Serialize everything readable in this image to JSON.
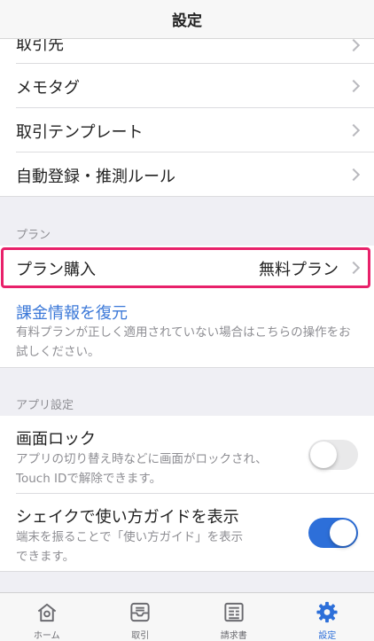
{
  "header": {
    "title": "設定"
  },
  "top_rows": [
    {
      "label": "取引先"
    },
    {
      "label": "メモタグ"
    },
    {
      "label": "取引テンプレート"
    },
    {
      "label": "自動登録・推測ルール"
    }
  ],
  "plan_section": {
    "title": "プラン",
    "purchase": {
      "label": "プラン購入",
      "value": "無料プラン"
    },
    "restore": {
      "link": "課金情報を復元",
      "description": "有料プランが正しく適用されていない場合はこちらの操作をお試しください。"
    }
  },
  "app_section": {
    "title": "アプリ設定",
    "screen_lock": {
      "label": "画面ロック",
      "description": "アプリの切り替え時などに画面がロックされ、Touch IDで解除できます。",
      "enabled": false
    },
    "shake_guide": {
      "label": "シェイクで使い方ガイドを表示",
      "description": "端末を振ることで「使い方ガイド」を表示できます。",
      "enabled": true
    }
  },
  "tabbar": {
    "items": [
      {
        "label": "ホーム",
        "icon": "home-icon"
      },
      {
        "label": "取引",
        "icon": "inbox-icon"
      },
      {
        "label": "請求書",
        "icon": "invoice-icon"
      },
      {
        "label": "設定",
        "icon": "gear-icon"
      }
    ],
    "active_index": 3
  },
  "colors": {
    "accent": "#2d6fd9",
    "highlight": "#e8216a",
    "link": "#3b78d8"
  }
}
